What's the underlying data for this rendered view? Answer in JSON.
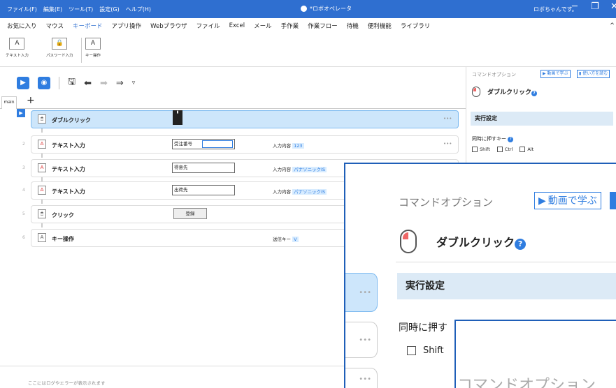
{
  "titlebar": {
    "menu": [
      "ファイル(F)",
      "編集(E)",
      "ツール(T)",
      "設定(G)",
      "ヘルプ(H)"
    ],
    "app_title": "*ロボオペレータ",
    "user": "ロボちゃんです。",
    "min": "─",
    "max": "❐",
    "close": "✕"
  },
  "ribbon_tabs": [
    "お気に入り",
    "マウス",
    "キーボード",
    "アプリ操作",
    "Webブラウザ",
    "ファイル",
    "Excel",
    "メール",
    "手作業",
    "作業フロー",
    "待機",
    "便利機能",
    "ライブラリ"
  ],
  "ribbon_collapse": "^",
  "ribbon_buttons": [
    {
      "label": "テキスト入力",
      "icon": "A"
    },
    {
      "label": "パスワード入力",
      "icon": "🔒"
    },
    {
      "label": "キー操作",
      "icon": "A"
    }
  ],
  "toolbar": {
    "play": "▶",
    "record": "◉",
    "save": "🖫",
    "undo": "⬅",
    "redo": "➡",
    "export": "⇒",
    "more": "▿"
  },
  "tabs": {
    "main": "main",
    "add": "+"
  },
  "rows": [
    {
      "num": "",
      "label": "ダブルクリック",
      "icon": "🖱",
      "field": "",
      "info_label": "",
      "info_value": "",
      "dots": "•••"
    },
    {
      "num": "2",
      "label": "テキスト入力",
      "icon": "A",
      "field": "受注番号",
      "info_label": "入力内容",
      "info_value": "123",
      "dots": "•••"
    },
    {
      "num": "3",
      "label": "テキスト入力",
      "icon": "A",
      "field": "得意先",
      "info_label": "入力内容",
      "info_value": "パナソニックIS",
      "dots": ""
    },
    {
      "num": "4",
      "label": "テキスト入力",
      "icon": "A",
      "field": "出荷先",
      "info_label": "入力内容",
      "info_value": "パナソニックIS",
      "dots": ""
    },
    {
      "num": "5",
      "label": "クリック",
      "icon": "🖱",
      "field": "登録",
      "info_label": "",
      "info_value": "",
      "dots": ""
    },
    {
      "num": "6",
      "label": "キー操作",
      "icon": "A",
      "field": "",
      "info_label": "送信キー",
      "info_value": "V",
      "dots": ""
    }
  ],
  "logbar": "ここにはログやエラーが表示されます",
  "right_pane": {
    "header": "コマンドオプション",
    "video_btn": "動画で学ぶ",
    "howto_btn": "使い方を読む",
    "command_title": "ダブルクリック",
    "help": "?",
    "section": "実行設定",
    "simultaneous": "同時に押すキー",
    "checks": [
      "Shift",
      "Ctrl",
      "Alt"
    ]
  },
  "overlay1": {
    "header": "コマンドオプション",
    "video_btn": "動画で学ぶ",
    "command_title": "ダブルクリック",
    "help": "?",
    "section": "実行設定",
    "simultaneous": "同時に押す",
    "shift": "Shift",
    "row_dots": "•••"
  },
  "overlay2": {
    "header": "コマンドオプション"
  }
}
